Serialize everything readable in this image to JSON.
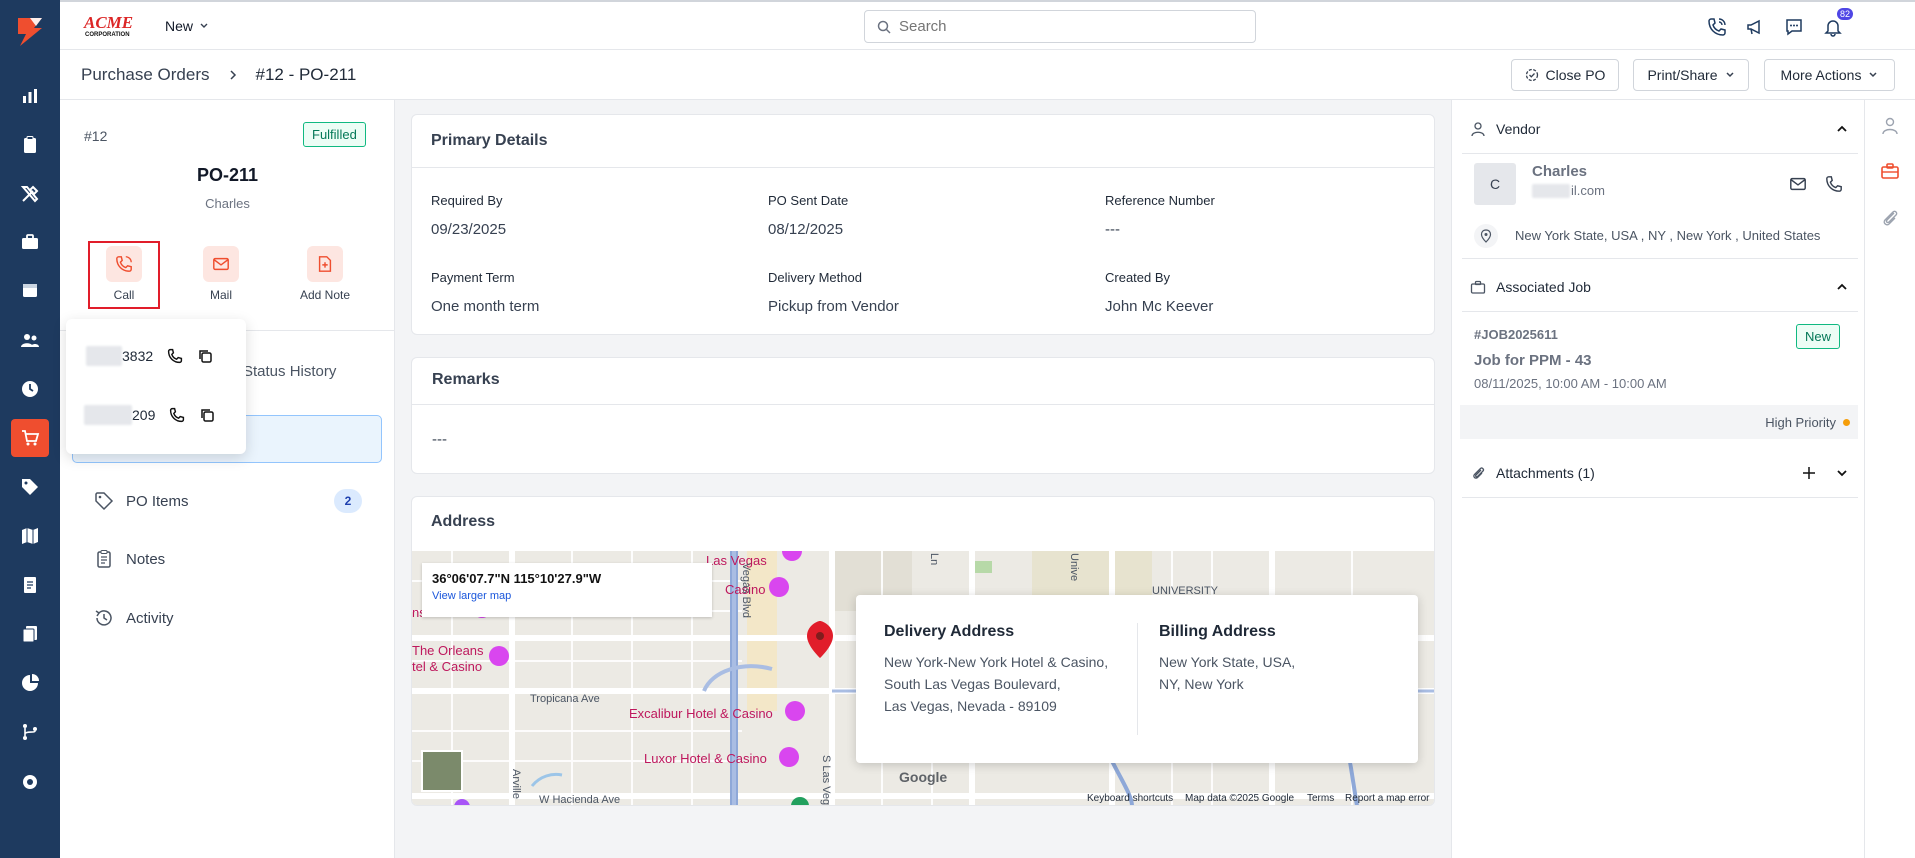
{
  "topbar": {
    "brand_text": "ACME CORPORATION",
    "new_label": "New",
    "search_placeholder": "Search",
    "notification_count": "82"
  },
  "breadcrumb": {
    "root": "Purchase Orders",
    "current": "#12 - PO-211"
  },
  "actions": {
    "close_po": "Close PO",
    "print_share": "Print/Share",
    "more_actions": "More Actions"
  },
  "summary": {
    "number": "#12",
    "status": "Fulfilled",
    "title": "PO-211",
    "vendor": "Charles",
    "quick_actions": {
      "call": "Call",
      "mail": "Mail",
      "add_note": "Add Note"
    },
    "status_history_tab": "Status History"
  },
  "call_popover": {
    "phones": [
      {
        "suffix": "3832"
      },
      {
        "suffix": "209"
      }
    ]
  },
  "left_nav": [
    {
      "label": "PO Items",
      "count": "2"
    },
    {
      "label": "Notes"
    },
    {
      "label": "Activity"
    }
  ],
  "primary_details": {
    "title": "Primary Details",
    "fields": [
      {
        "label": "Required By",
        "value": "09/23/2025"
      },
      {
        "label": "PO Sent Date",
        "value": "08/12/2025"
      },
      {
        "label": "Reference Number",
        "value": "---"
      },
      {
        "label": "Payment Term",
        "value": "One month term"
      },
      {
        "label": "Delivery Method",
        "value": "Pickup from Vendor"
      },
      {
        "label": "Created By",
        "value": "John Mc Keever"
      }
    ]
  },
  "remarks": {
    "title": "Remarks",
    "value": "---"
  },
  "address": {
    "title": "Address",
    "map": {
      "coords": "36°06'07.7\"N 115°10'27.9\"W",
      "view_larger": "View larger map",
      "places": [
        "Las Vegas",
        "Casino",
        "The Orleans",
        "tel & Casino",
        "Excalibur Hotel & Casino",
        "Luxor Hotel & Casino",
        "ns Arena"
      ],
      "roads": [
        "Tropicana Ave",
        "W Hacienda Ave",
        "Vegas Blvd",
        "S Las Veg",
        "Arville",
        "UNIVERSITY",
        "Unive",
        "Ln"
      ],
      "footer": {
        "shortcuts": "Keyboard shortcuts",
        "data": "Map data ©2025 Google",
        "terms": "Terms",
        "report": "Report a map error"
      },
      "google": "Google"
    },
    "delivery": {
      "title": "Delivery Address",
      "lines": [
        "New York-New York Hotel & Casino,",
        "South Las Vegas Boulevard,",
        "Las Vegas, Nevada - 89109"
      ]
    },
    "billing": {
      "title": "Billing Address",
      "lines": [
        "New York State, USA,",
        "NY, New York"
      ]
    }
  },
  "vendor_panel": {
    "title": "Vendor",
    "initial": "C",
    "name": "Charles",
    "email_tail": "il.com",
    "location": "New York State, USA , NY , New York , United States"
  },
  "job_panel": {
    "title": "Associated Job",
    "job_id": "#JOB2025611",
    "status": "New",
    "job_name": "Job for PPM - 43",
    "schedule": "08/11/2025, 10:00 AM - 10:00 AM",
    "priority": "High Priority"
  },
  "attachments": {
    "title": "Attachments (1)"
  },
  "colors": {
    "accent": "#ef4e2f",
    "rail": "#1e3a5f",
    "success": "#10b981",
    "priority": "#f59e0b"
  }
}
